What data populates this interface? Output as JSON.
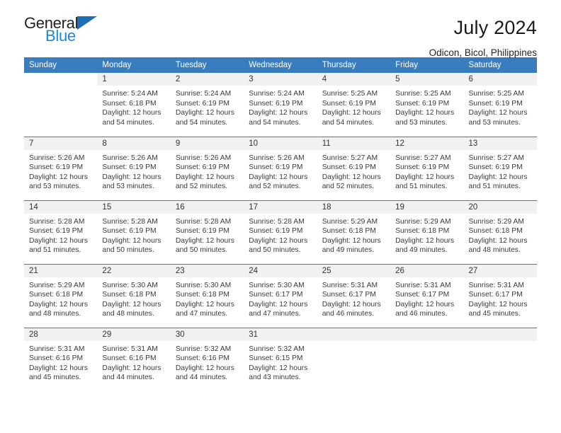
{
  "brand": {
    "name_part1": "General",
    "name_part2": "Blue",
    "triangle_color": "#1e6eb5",
    "blue_color": "#1b87d8"
  },
  "header": {
    "title": "July 2024",
    "subtitle": "Odicon, Bicol, Philippines"
  },
  "theme": {
    "header_bar_color": "#3a7dbe",
    "daynum_background": "#f1f1f1",
    "text_color": "#3a3a3a"
  },
  "weekdays": [
    "Sunday",
    "Monday",
    "Tuesday",
    "Wednesday",
    "Thursday",
    "Friday",
    "Saturday"
  ],
  "labels": {
    "sunrise_prefix": "Sunrise:",
    "sunset_prefix": "Sunset:",
    "daylight_prefix": "Daylight:"
  },
  "weeks": [
    [
      {
        "day": "",
        "sunrise": "",
        "sunset": "",
        "daylight_line1": "",
        "daylight_line2": "",
        "blank": true
      },
      {
        "day": "1",
        "sunrise": "Sunrise: 5:24 AM",
        "sunset": "Sunset: 6:18 PM",
        "daylight_line1": "Daylight: 12 hours",
        "daylight_line2": "and 54 minutes."
      },
      {
        "day": "2",
        "sunrise": "Sunrise: 5:24 AM",
        "sunset": "Sunset: 6:19 PM",
        "daylight_line1": "Daylight: 12 hours",
        "daylight_line2": "and 54 minutes."
      },
      {
        "day": "3",
        "sunrise": "Sunrise: 5:24 AM",
        "sunset": "Sunset: 6:19 PM",
        "daylight_line1": "Daylight: 12 hours",
        "daylight_line2": "and 54 minutes."
      },
      {
        "day": "4",
        "sunrise": "Sunrise: 5:25 AM",
        "sunset": "Sunset: 6:19 PM",
        "daylight_line1": "Daylight: 12 hours",
        "daylight_line2": "and 54 minutes."
      },
      {
        "day": "5",
        "sunrise": "Sunrise: 5:25 AM",
        "sunset": "Sunset: 6:19 PM",
        "daylight_line1": "Daylight: 12 hours",
        "daylight_line2": "and 53 minutes."
      },
      {
        "day": "6",
        "sunrise": "Sunrise: 5:25 AM",
        "sunset": "Sunset: 6:19 PM",
        "daylight_line1": "Daylight: 12 hours",
        "daylight_line2": "and 53 minutes."
      }
    ],
    [
      {
        "day": "7",
        "sunrise": "Sunrise: 5:26 AM",
        "sunset": "Sunset: 6:19 PM",
        "daylight_line1": "Daylight: 12 hours",
        "daylight_line2": "and 53 minutes."
      },
      {
        "day": "8",
        "sunrise": "Sunrise: 5:26 AM",
        "sunset": "Sunset: 6:19 PM",
        "daylight_line1": "Daylight: 12 hours",
        "daylight_line2": "and 53 minutes."
      },
      {
        "day": "9",
        "sunrise": "Sunrise: 5:26 AM",
        "sunset": "Sunset: 6:19 PM",
        "daylight_line1": "Daylight: 12 hours",
        "daylight_line2": "and 52 minutes."
      },
      {
        "day": "10",
        "sunrise": "Sunrise: 5:26 AM",
        "sunset": "Sunset: 6:19 PM",
        "daylight_line1": "Daylight: 12 hours",
        "daylight_line2": "and 52 minutes."
      },
      {
        "day": "11",
        "sunrise": "Sunrise: 5:27 AM",
        "sunset": "Sunset: 6:19 PM",
        "daylight_line1": "Daylight: 12 hours",
        "daylight_line2": "and 52 minutes."
      },
      {
        "day": "12",
        "sunrise": "Sunrise: 5:27 AM",
        "sunset": "Sunset: 6:19 PM",
        "daylight_line1": "Daylight: 12 hours",
        "daylight_line2": "and 51 minutes."
      },
      {
        "day": "13",
        "sunrise": "Sunrise: 5:27 AM",
        "sunset": "Sunset: 6:19 PM",
        "daylight_line1": "Daylight: 12 hours",
        "daylight_line2": "and 51 minutes."
      }
    ],
    [
      {
        "day": "14",
        "sunrise": "Sunrise: 5:28 AM",
        "sunset": "Sunset: 6:19 PM",
        "daylight_line1": "Daylight: 12 hours",
        "daylight_line2": "and 51 minutes."
      },
      {
        "day": "15",
        "sunrise": "Sunrise: 5:28 AM",
        "sunset": "Sunset: 6:19 PM",
        "daylight_line1": "Daylight: 12 hours",
        "daylight_line2": "and 50 minutes."
      },
      {
        "day": "16",
        "sunrise": "Sunrise: 5:28 AM",
        "sunset": "Sunset: 6:19 PM",
        "daylight_line1": "Daylight: 12 hours",
        "daylight_line2": "and 50 minutes."
      },
      {
        "day": "17",
        "sunrise": "Sunrise: 5:28 AM",
        "sunset": "Sunset: 6:19 PM",
        "daylight_line1": "Daylight: 12 hours",
        "daylight_line2": "and 50 minutes."
      },
      {
        "day": "18",
        "sunrise": "Sunrise: 5:29 AM",
        "sunset": "Sunset: 6:18 PM",
        "daylight_line1": "Daylight: 12 hours",
        "daylight_line2": "and 49 minutes."
      },
      {
        "day": "19",
        "sunrise": "Sunrise: 5:29 AM",
        "sunset": "Sunset: 6:18 PM",
        "daylight_line1": "Daylight: 12 hours",
        "daylight_line2": "and 49 minutes."
      },
      {
        "day": "20",
        "sunrise": "Sunrise: 5:29 AM",
        "sunset": "Sunset: 6:18 PM",
        "daylight_line1": "Daylight: 12 hours",
        "daylight_line2": "and 48 minutes."
      }
    ],
    [
      {
        "day": "21",
        "sunrise": "Sunrise: 5:29 AM",
        "sunset": "Sunset: 6:18 PM",
        "daylight_line1": "Daylight: 12 hours",
        "daylight_line2": "and 48 minutes."
      },
      {
        "day": "22",
        "sunrise": "Sunrise: 5:30 AM",
        "sunset": "Sunset: 6:18 PM",
        "daylight_line1": "Daylight: 12 hours",
        "daylight_line2": "and 48 minutes."
      },
      {
        "day": "23",
        "sunrise": "Sunrise: 5:30 AM",
        "sunset": "Sunset: 6:18 PM",
        "daylight_line1": "Daylight: 12 hours",
        "daylight_line2": "and 47 minutes."
      },
      {
        "day": "24",
        "sunrise": "Sunrise: 5:30 AM",
        "sunset": "Sunset: 6:17 PM",
        "daylight_line1": "Daylight: 12 hours",
        "daylight_line2": "and 47 minutes."
      },
      {
        "day": "25",
        "sunrise": "Sunrise: 5:31 AM",
        "sunset": "Sunset: 6:17 PM",
        "daylight_line1": "Daylight: 12 hours",
        "daylight_line2": "and 46 minutes."
      },
      {
        "day": "26",
        "sunrise": "Sunrise: 5:31 AM",
        "sunset": "Sunset: 6:17 PM",
        "daylight_line1": "Daylight: 12 hours",
        "daylight_line2": "and 46 minutes."
      },
      {
        "day": "27",
        "sunrise": "Sunrise: 5:31 AM",
        "sunset": "Sunset: 6:17 PM",
        "daylight_line1": "Daylight: 12 hours",
        "daylight_line2": "and 45 minutes."
      }
    ],
    [
      {
        "day": "28",
        "sunrise": "Sunrise: 5:31 AM",
        "sunset": "Sunset: 6:16 PM",
        "daylight_line1": "Daylight: 12 hours",
        "daylight_line2": "and 45 minutes."
      },
      {
        "day": "29",
        "sunrise": "Sunrise: 5:31 AM",
        "sunset": "Sunset: 6:16 PM",
        "daylight_line1": "Daylight: 12 hours",
        "daylight_line2": "and 44 minutes."
      },
      {
        "day": "30",
        "sunrise": "Sunrise: 5:32 AM",
        "sunset": "Sunset: 6:16 PM",
        "daylight_line1": "Daylight: 12 hours",
        "daylight_line2": "and 44 minutes."
      },
      {
        "day": "31",
        "sunrise": "Sunrise: 5:32 AM",
        "sunset": "Sunset: 6:15 PM",
        "daylight_line1": "Daylight: 12 hours",
        "daylight_line2": "and 43 minutes."
      },
      {
        "day": "",
        "sunrise": "",
        "sunset": "",
        "daylight_line1": "",
        "daylight_line2": "",
        "empty": true
      },
      {
        "day": "",
        "sunrise": "",
        "sunset": "",
        "daylight_line1": "",
        "daylight_line2": "",
        "empty": true
      },
      {
        "day": "",
        "sunrise": "",
        "sunset": "",
        "daylight_line1": "",
        "daylight_line2": "",
        "empty": true
      }
    ]
  ]
}
